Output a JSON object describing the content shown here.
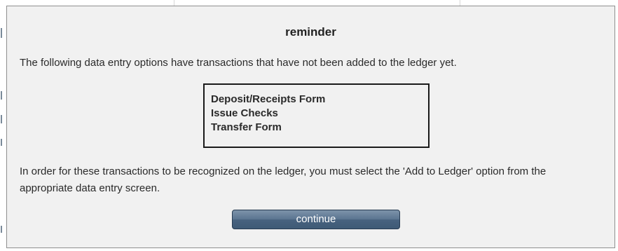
{
  "dialog": {
    "title": "reminder",
    "intro": "The following data entry options have transactions that have not been added to the ledger yet.",
    "pending_options": [
      "Deposit/Receipts Form",
      "Issue Checks",
      "Transfer Form"
    ],
    "note": "In order for these transactions to be recognized on the ledger, you must select the 'Add to Ledger' option from the appropriate data entry screen.",
    "continue_label": "continue"
  },
  "colors": {
    "dialog_background": "#f1f1f1",
    "button_top": "#7d93aa",
    "button_bottom": "#3f5a76",
    "box_border": "#1a1a1a"
  }
}
